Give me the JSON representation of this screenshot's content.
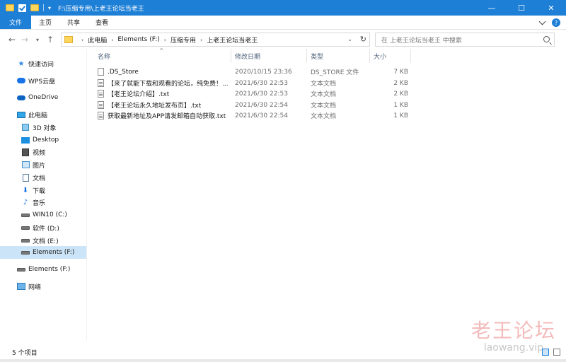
{
  "window": {
    "title": "F:\\压缩专用\\上老王论坛当老王",
    "controls": [
      "—",
      "☐",
      "✕"
    ]
  },
  "ribbon": {
    "tabs": [
      "文件",
      "主页",
      "共享",
      "查看"
    ],
    "help": "?"
  },
  "address": {
    "crumbs": [
      "此电脑",
      "Elements (F:)",
      "压缩专用",
      "上老王论坛当老王"
    ],
    "search_placeholder": "在 上老王论坛当老王 中搜索"
  },
  "nav": {
    "items": [
      {
        "label": "快速访问",
        "icon": "star-icon"
      },
      {
        "label": "WPS云盘",
        "icon": "cloud-icon"
      },
      {
        "label": "OneDrive",
        "icon": "onedrive-icon"
      },
      {
        "label": "此电脑",
        "icon": "pc-icon"
      },
      {
        "label": "3D 对象",
        "icon": "3d-objects-icon"
      },
      {
        "label": "Desktop",
        "icon": "desktop-icon"
      },
      {
        "label": "视频",
        "icon": "video-icon"
      },
      {
        "label": "图片",
        "icon": "pictures-icon"
      },
      {
        "label": "文档",
        "icon": "documents-icon"
      },
      {
        "label": "下载",
        "icon": "download-icon"
      },
      {
        "label": "音乐",
        "icon": "music-icon"
      },
      {
        "label": "WIN10 (C:)",
        "icon": "drive-icon"
      },
      {
        "label": "软件 (D:)",
        "icon": "drive-icon"
      },
      {
        "label": "文档 (E:)",
        "icon": "drive-icon"
      },
      {
        "label": "Elements (F:)",
        "icon": "drive-icon"
      },
      {
        "label": "Elements (F:)",
        "icon": "drive-icon"
      },
      {
        "label": "网络",
        "icon": "network-icon"
      }
    ],
    "selected": "Elements (F:)"
  },
  "columns": {
    "name": "名称",
    "date": "修改日期",
    "type": "类型",
    "size": "大小"
  },
  "files": [
    {
      "name": ".DS_Store",
      "date": "2020/10/15 23:36",
      "type": "DS_STORE 文件",
      "size": "7 KB",
      "icon": "blank-file-icon"
    },
    {
      "name": "【来了就能下载和观看的论坛，纯免费！...",
      "date": "2021/6/30 22:53",
      "type": "文本文档",
      "size": "2 KB",
      "icon": "text-file-icon"
    },
    {
      "name": "【老王论坛介绍】.txt",
      "date": "2021/6/30 22:53",
      "type": "文本文档",
      "size": "2 KB",
      "icon": "text-file-icon"
    },
    {
      "name": "【老王论坛永久地址发布页】.txt",
      "date": "2021/6/30 22:54",
      "type": "文本文档",
      "size": "1 KB",
      "icon": "text-file-icon"
    },
    {
      "name": "获取最新地址及APP请发邮箱自动获取.txt",
      "date": "2021/6/30 22:54",
      "type": "文本文档",
      "size": "1 KB",
      "icon": "text-file-icon"
    }
  ],
  "status": {
    "item_count": "5 个项目"
  },
  "watermark": {
    "title": "老王论坛",
    "url": "laowang.vip"
  },
  "colors": {
    "titlebar": "#1e7fd6",
    "selected": "#cce4f7"
  }
}
